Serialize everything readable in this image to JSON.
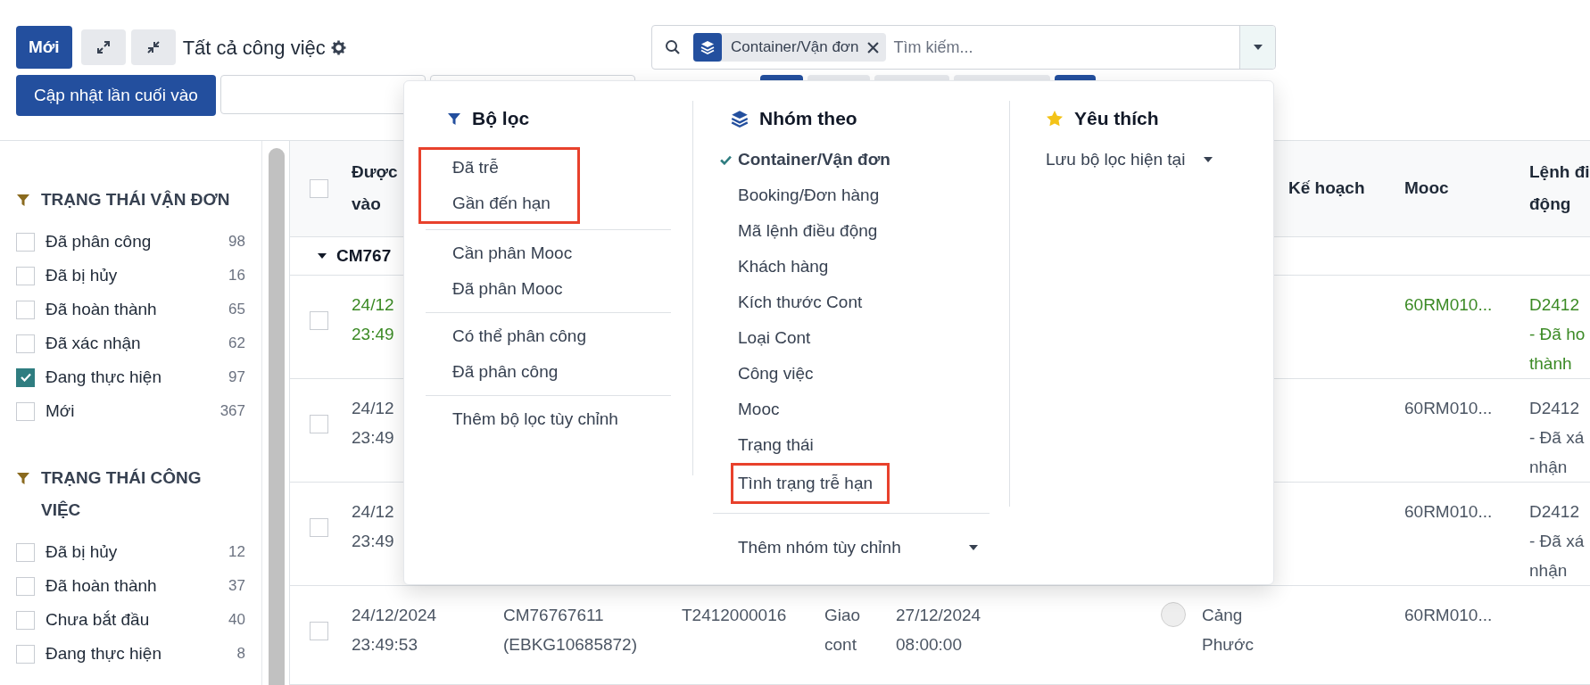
{
  "toolbar": {
    "new_button": "Mới",
    "title": "Tất cả công việc",
    "update_button": "Cập nhật lần cuối vào"
  },
  "search": {
    "facet": "Container/Vận đơn",
    "placeholder": "Tìm kiếm..."
  },
  "sidebar": {
    "sections": [
      {
        "title": "TRẠNG THÁI VẬN ĐƠN",
        "items": [
          {
            "label": "Đã phân công",
            "count": "98",
            "checked": false
          },
          {
            "label": "Đã bị hủy",
            "count": "16",
            "checked": false
          },
          {
            "label": "Đã hoàn thành",
            "count": "65",
            "checked": false
          },
          {
            "label": "Đã xác nhận",
            "count": "62",
            "checked": false
          },
          {
            "label": "Đang thực hiện",
            "count": "97",
            "checked": true
          },
          {
            "label": "Mới",
            "count": "367",
            "checked": false
          }
        ]
      },
      {
        "title": "TRẠNG THÁI CÔNG VIỆC",
        "items": [
          {
            "label": "Đã bị hủy",
            "count": "12",
            "checked": false
          },
          {
            "label": "Đã hoàn thành",
            "count": "37",
            "checked": false
          },
          {
            "label": "Chưa bắt đầu",
            "count": "40",
            "checked": false
          },
          {
            "label": "Đang thực hiện",
            "count": "8",
            "checked": false
          }
        ]
      }
    ]
  },
  "table": {
    "select_all_checked": false,
    "header": {
      "column_1": [
        "Được",
        "vào"
      ],
      "column_7": [
        "Kế hoạch"
      ],
      "column_8": [
        "Mooc"
      ],
      "column_9": [
        "Lệnh đi",
        "động"
      ]
    },
    "group": {
      "label": "CM767",
      "expanded": true
    },
    "rows": [
      {
        "color": "#3b8a25",
        "checked": false,
        "dot": false,
        "cells": {
          "column_1": [
            "24/12",
            "23:49"
          ],
          "column_8": [
            "60RM010..."
          ],
          "column_9": [
            "D2412",
            "- Đã ho",
            "thành"
          ]
        }
      },
      {
        "color": "#4b5563",
        "checked": false,
        "dot": false,
        "cells": {
          "column_1": [
            "24/12",
            "23:49"
          ],
          "column_8": [
            "60RM010..."
          ],
          "column_9": [
            "D2412",
            "- Đã xá",
            "nhận"
          ]
        }
      },
      {
        "color": "#4b5563",
        "checked": false,
        "dot": false,
        "cells": {
          "column_1": [
            "24/12",
            "23:49"
          ],
          "column_8": [
            "60RM010..."
          ],
          "column_9": [
            "D2412",
            "- Đã xá",
            "nhận"
          ]
        }
      },
      {
        "color": "#4b5563",
        "checked": false,
        "dot": true,
        "cells": {
          "column_1": [
            "24/12/2024",
            "23:49:53"
          ],
          "column_2": [
            "CM76767611",
            "(EBKG10685872)"
          ],
          "column_3": [
            "T2412000016"
          ],
          "column_4": [
            "Giao",
            "cont"
          ],
          "column_5": [
            "27/12/2024",
            "08:00:00"
          ],
          "column_6": [
            "Cảng",
            "Phước"
          ],
          "column_8": [
            "60RM010..."
          ]
        }
      }
    ]
  },
  "dropdown": {
    "filters": {
      "title": "Bộ lọc",
      "groups": [
        {
          "highlighted": true,
          "items": [
            "Đã trễ",
            "Gần đến hạn"
          ]
        },
        {
          "highlighted": false,
          "items": [
            "Cần phân Mooc",
            "Đã phân Mooc"
          ]
        },
        {
          "highlighted": false,
          "items": [
            "Có thể phân công",
            "Đã phân công"
          ]
        },
        {
          "highlighted": false,
          "items": [
            "Thêm bộ lọc tùy chỉnh"
          ]
        }
      ]
    },
    "group_by": {
      "title": "Nhóm theo",
      "items": [
        {
          "label": "Container/Vận đơn",
          "selected": true,
          "highlighted": false
        },
        {
          "label": "Booking/Đơn hàng",
          "selected": false,
          "highlighted": false
        },
        {
          "label": "Mã lệnh điều động",
          "selected": false,
          "highlighted": false
        },
        {
          "label": "Khách hàng",
          "selected": false,
          "highlighted": false
        },
        {
          "label": "Kích thước Cont",
          "selected": false,
          "highlighted": false
        },
        {
          "label": "Loại Cont",
          "selected": false,
          "highlighted": false
        },
        {
          "label": "Công việc",
          "selected": false,
          "highlighted": false
        },
        {
          "label": "Mooc",
          "selected": false,
          "highlighted": false
        },
        {
          "label": "Trạng thái",
          "selected": false,
          "highlighted": false
        },
        {
          "label": "Tình trạng trễ hạn",
          "selected": false,
          "highlighted": true
        }
      ],
      "custom": "Thêm nhóm tùy chỉnh"
    },
    "favorites": {
      "title": "Yêu thích",
      "save": "Lưu bộ lọc hiện tại"
    }
  }
}
